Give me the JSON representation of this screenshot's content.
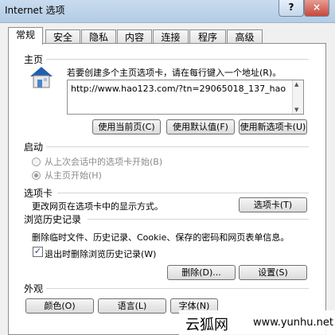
{
  "window": {
    "title": "Internet 选项",
    "help_button": "?",
    "close_button": "×"
  },
  "tabs": [
    {
      "label": "常规"
    },
    {
      "label": "安全"
    },
    {
      "label": "隐私"
    },
    {
      "label": "内容"
    },
    {
      "label": "连接"
    },
    {
      "label": "程序"
    },
    {
      "label": "高级"
    }
  ],
  "home": {
    "section_title": "主页",
    "instruction": "若要创建多个主页选项卡，请在每行键入一个地址(R)。",
    "url": "http://www.hao123.com/?tn=29065018_137_hao",
    "buttons": {
      "current": "使用当前页(C)",
      "default": "使用默认值(F)",
      "new_tab": "使用新选项卡(U)"
    }
  },
  "startup": {
    "section_title": "启动",
    "option1": "从上次会话中的选项卡开始(B)",
    "option2": "从主页开始(H)"
  },
  "tabs_section": {
    "section_title": "选项卡",
    "desc": "更改网页在选项卡中的显示方式。",
    "button": "选项卡(T)"
  },
  "history": {
    "section_title": "浏览历史记录",
    "desc": "删除临时文件、历史记录、Cookie、保存的密码和网页表单信息。",
    "checkbox_label": "退出时删除浏览历史记录(W)",
    "delete_button": "删除(D)...",
    "settings_button": "设置(S)"
  },
  "appearance": {
    "section_title": "外观",
    "colors_button": "颜色(O)",
    "languages_button": "语言(L)",
    "fonts_button": "字体(N)"
  },
  "watermark": {
    "name": "云狐网",
    "url": "www.yunhu.net"
  }
}
